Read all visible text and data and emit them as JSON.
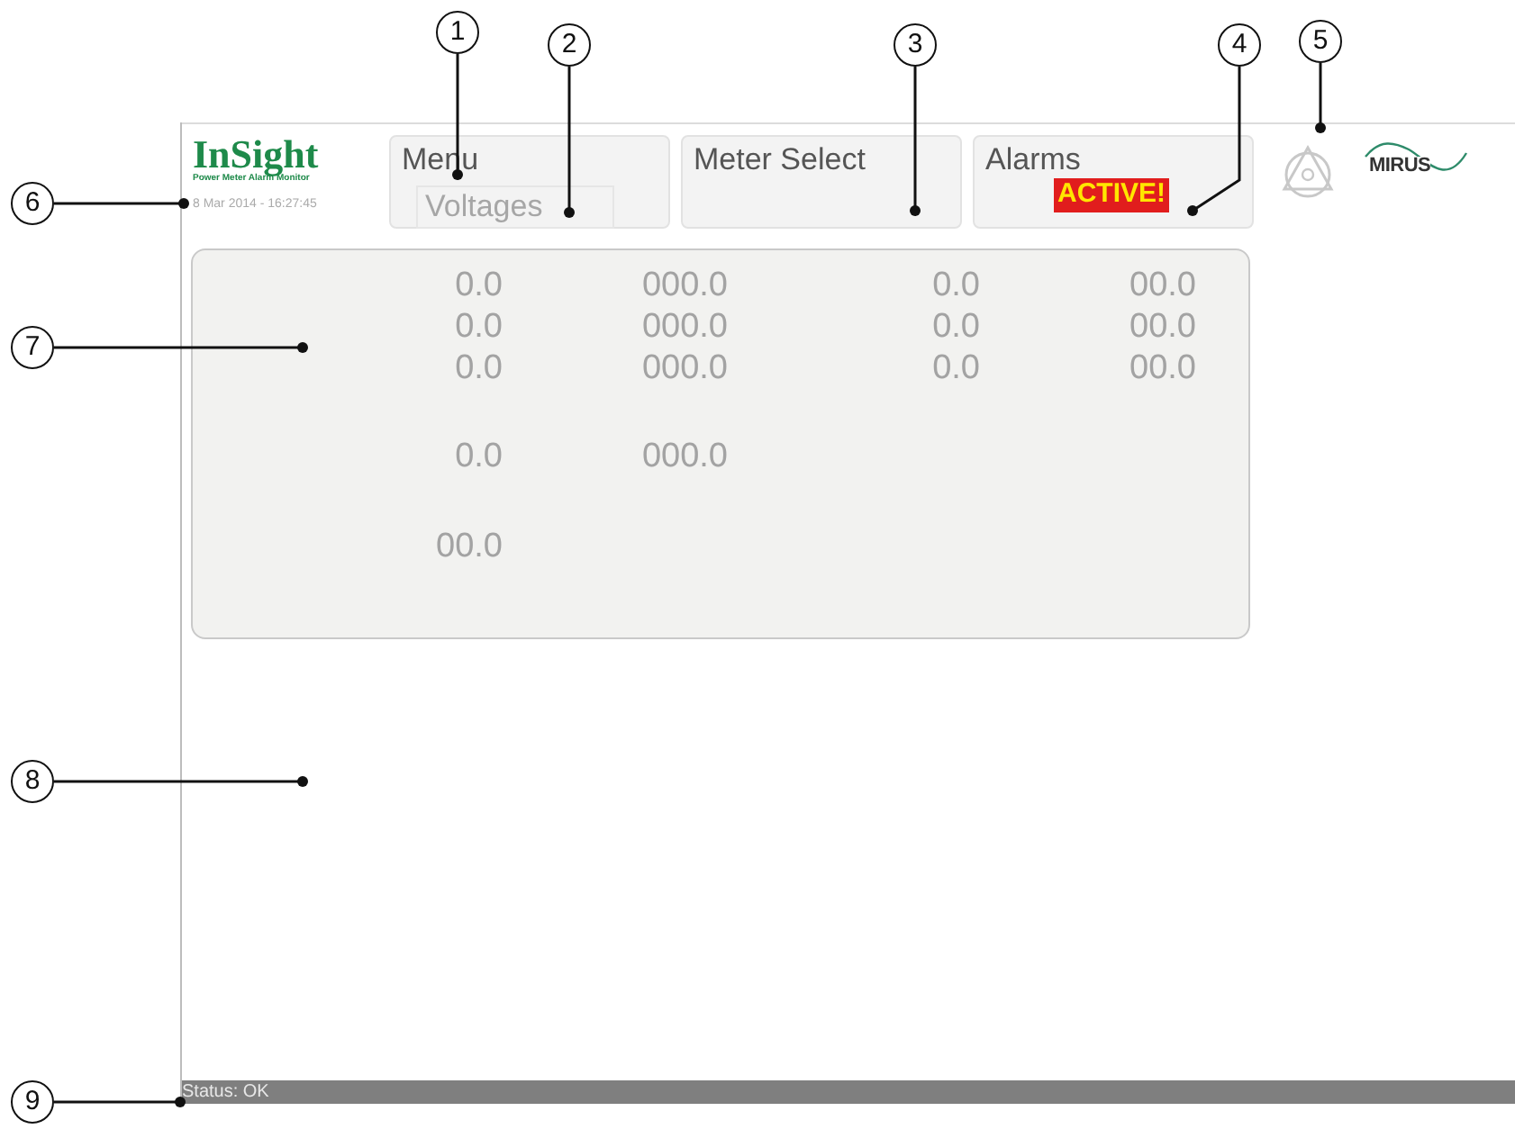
{
  "header": {
    "logo": "InSight",
    "logo_tagline": "Power Meter Alarm Monitor",
    "datetime": "8 Mar 2014 - 16:27:45"
  },
  "buttons": [
    {
      "kind": "menu",
      "label": "Menu",
      "sub_label": "Voltages"
    },
    {
      "kind": "plain",
      "label": "Meter Select"
    },
    {
      "kind": "alarm",
      "label": "Alarms",
      "badge": "ACTIVE!"
    }
  ],
  "brand_logo": "MIRUS",
  "readings": [
    {
      "values": [
        "0.0",
        "000.0",
        "0.0",
        "00.0"
      ]
    },
    {
      "values": [
        "0.0",
        "000.0",
        "0.0",
        "00.0"
      ]
    },
    {
      "values": [
        "0.0",
        "000.0",
        "0.0",
        "00.0"
      ]
    },
    {
      "values": [
        "0.0",
        "000.0"
      ]
    },
    {
      "values": [
        "00.0"
      ]
    }
  ],
  "status_bar": "Status: OK",
  "callouts": [
    "1",
    "2",
    "3",
    "4",
    "5",
    "6",
    "7",
    "8",
    "9"
  ]
}
